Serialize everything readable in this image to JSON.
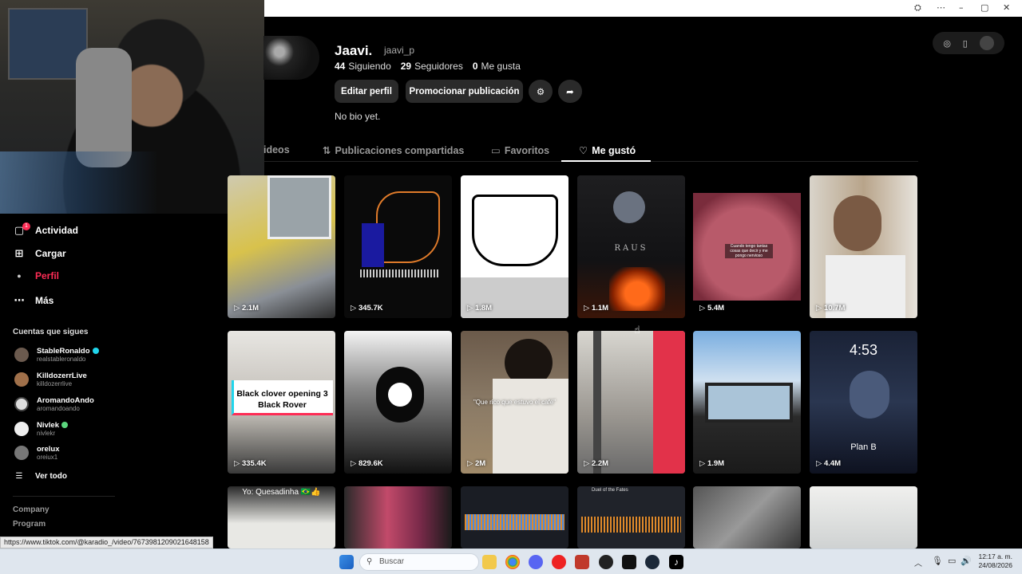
{
  "profile": {
    "display_name": "Jaavi.",
    "handle": "jaavi_p",
    "following_count": "44",
    "following_label": "Siguiendo",
    "followers_count": "29",
    "followers_label": "Seguidores",
    "likes_count": "0",
    "likes_label": "Me gusta",
    "edit_button": "Editar perfil",
    "promote_button": "Promocionar publicación",
    "bio": "No bio yet."
  },
  "tabs": [
    {
      "label": "Videos",
      "visible_label": "ideos",
      "icon": "grid-icon",
      "active": false
    },
    {
      "label": "Publicaciones compartidas",
      "icon": "repost-icon",
      "active": false
    },
    {
      "label": "Favoritos",
      "icon": "bookmark-icon",
      "active": false
    },
    {
      "label": "Me gustó",
      "icon": "heart-icon",
      "active": true
    }
  ],
  "sidebar": {
    "items": [
      {
        "label": "Actividad",
        "icon": "inbox-icon",
        "badge": "1"
      },
      {
        "label": "Cargar",
        "icon": "plus-square-icon"
      },
      {
        "label": "Perfil",
        "icon": "avatar-dot-icon",
        "active": true
      },
      {
        "label": "Más",
        "icon": "more-dots-icon"
      }
    ],
    "following_title": "Cuentas que sigues",
    "following": [
      {
        "name": "StableRonaldo",
        "handle": "realstableronaldo",
        "verified": true,
        "badge_color": "#20d5ec"
      },
      {
        "name": "KilldozerrLive",
        "handle": "killdozerrlive",
        "verified": false
      },
      {
        "name": "AromandoAndo",
        "handle": "aromandoando",
        "verified": false
      },
      {
        "name": "Nivlek",
        "handle": "nivlekr",
        "verified": true,
        "badge_color": "#5bd67d"
      },
      {
        "name": "orelux",
        "handle": "oreiux1",
        "verified": false
      }
    ],
    "see_all": "Ver todo",
    "footer_links": [
      "Company",
      "Program"
    ]
  },
  "videos": [
    {
      "views": "2.1M"
    },
    {
      "views": "345.7K"
    },
    {
      "views": "1.8M"
    },
    {
      "views": "1.1M",
      "caption": "RAUS"
    },
    {
      "views": "5.4M",
      "caption": "Cuando tengo tantas cosas que decir y me pongo nervioso"
    },
    {
      "views": "10.7M"
    },
    {
      "views": "335.4K",
      "caption": "Black clover opening 3 Black Rover"
    },
    {
      "views": "829.6K"
    },
    {
      "views": "2M",
      "caption": "\"Que rico que estuvo el café\""
    },
    {
      "views": "2.2M"
    },
    {
      "views": "1.9M"
    },
    {
      "views": "4.4M",
      "caption": "4:53",
      "caption2": "Plan B"
    },
    {
      "views": "",
      "caption": "Yo: Quesadinha 🇧🇷👍"
    },
    {
      "views": ""
    },
    {
      "views": ""
    },
    {
      "views": "",
      "caption": "Duel of the Fates"
    },
    {
      "views": ""
    },
    {
      "views": ""
    }
  ],
  "status_url": "https://www.tiktok.com/@karadio_/video/7673981209021648158",
  "taskbar": {
    "search_placeholder": "Buscar",
    "time": "12:17 a. m.",
    "date": "24/08/2026"
  },
  "colors": {
    "accent": "#fe2c55",
    "background": "#000000",
    "button": "#2a2a2a"
  }
}
